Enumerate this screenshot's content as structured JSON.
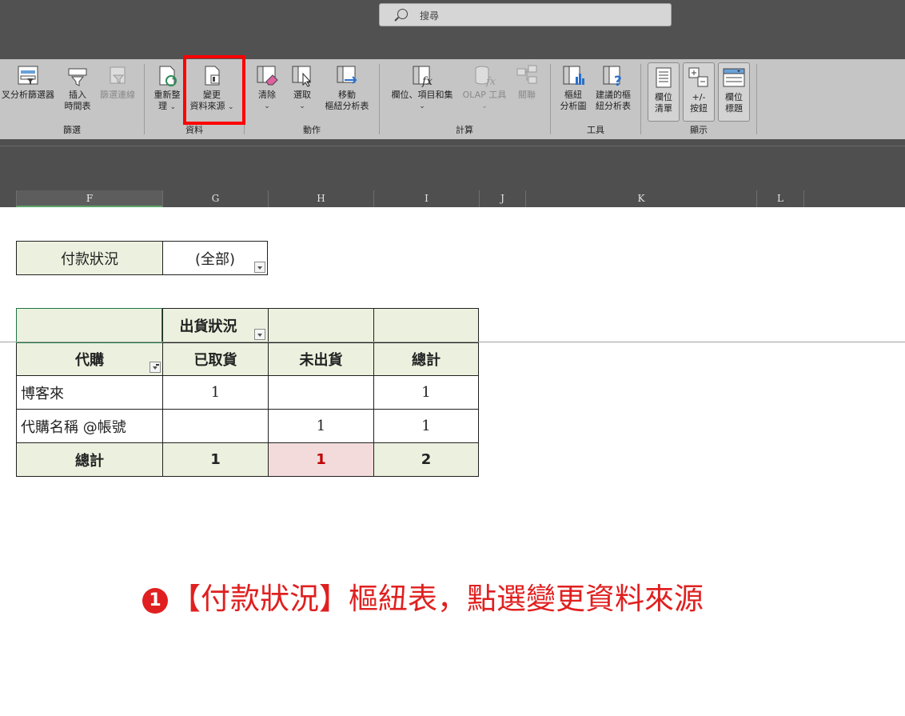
{
  "search": {
    "placeholder": "搜尋"
  },
  "ribbon": {
    "groups": {
      "filter": {
        "label": "篩選",
        "buttons": [
          "叉分析篩選器",
          "插入",
          "時間表",
          "篩選連線"
        ]
      },
      "data": {
        "label": "資料",
        "refresh": [
          "重新整",
          "理"
        ],
        "change_source": [
          "變更",
          "資料來源"
        ]
      },
      "actions": {
        "label": "動作",
        "clear": "清除",
        "select": "選取",
        "move": [
          "移動",
          "樞紐分析表"
        ]
      },
      "calc": {
        "label": "計算",
        "fields": "欄位、項目和集",
        "olap": "OLAP 工具",
        "relations": "關聯"
      },
      "tools": {
        "label": "工具",
        "pivot_chart": [
          "樞紐",
          "分析圖"
        ],
        "recommended": [
          "建議的樞",
          "紐分析表"
        ]
      },
      "show": {
        "label": "顯示",
        "field_list": [
          "欄位",
          "清單"
        ],
        "buttons": [
          "+/-",
          "按鈕"
        ],
        "headers": [
          "欄位",
          "標題"
        ]
      }
    }
  },
  "columns": [
    "F",
    "G",
    "H",
    "I",
    "J",
    "K",
    "L"
  ],
  "filter_row": {
    "label": "付款狀況",
    "value": "(全部)"
  },
  "pivot": {
    "col_field": "出貨狀況",
    "row_field": "代購",
    "col_headers": [
      "已取貨",
      "未出貨",
      "總計"
    ],
    "rows": [
      {
        "name": "博客來",
        "values": [
          "1",
          "",
          "1"
        ]
      },
      {
        "name": "代購名稱 @帳號",
        "values": [
          "",
          "1",
          "1"
        ]
      }
    ],
    "total": {
      "name": "總計",
      "values": [
        "1",
        "1",
        "2"
      ]
    }
  },
  "caption": {
    "number": "1",
    "text": "【付款狀況】樞紐表，點選變更資料來源"
  },
  "colors": {
    "highlight": "#ff0000",
    "caption": "#e02020",
    "green_fill": "#ebf1de",
    "pink_fill": "#f4dbdb"
  }
}
